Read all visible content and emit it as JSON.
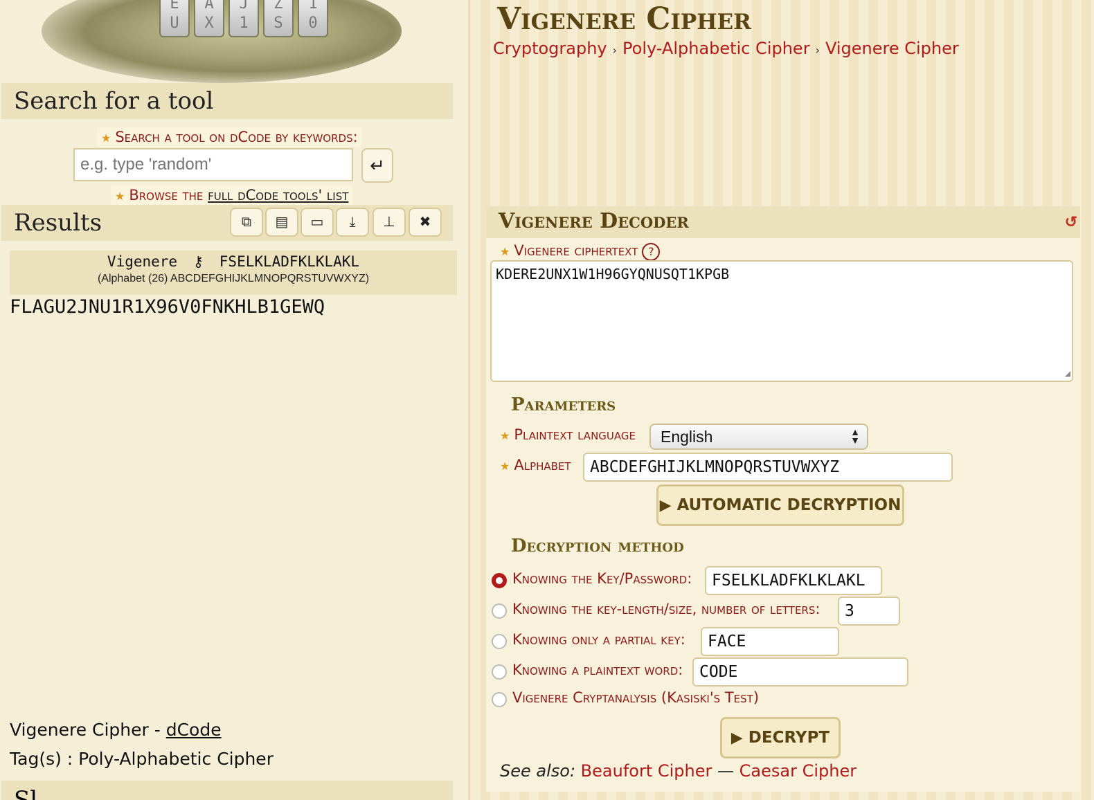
{
  "left": {
    "lock_ring_letters": [
      "E",
      "U",
      "A",
      "X",
      "J",
      "1",
      "Z",
      "S",
      "1",
      "0"
    ],
    "search_heading": "Search for a tool",
    "search_hint": "Search a tool on dCode by keywords:",
    "search_placeholder": "e.g. type 'random'",
    "browse_prefix": "Browse the ",
    "browse_link": "full dCode tools' list",
    "results_heading": "Results",
    "result_cipher_name": "Vigenere",
    "result_key": "FSELKLADFKLKLAKL",
    "result_alphabet": "(Alphabet (26) ABCDEFGHIJKLMNOPQRSTUVWXYZ)",
    "result_plaintext": "FLAGU2JNU1R1X96V0FNKHLB1GEWQ",
    "footer_title": "Vigenere Cipher - ",
    "footer_link": "dCode",
    "footer_tags": "Tag(s) : Poly-Alphabetic Cipher",
    "bottom_cut_heading": "Sl"
  },
  "right": {
    "page_title": "Vigenere Cipher",
    "breadcrumb": [
      "Cryptography",
      "Poly-Alphabetic Cipher",
      "Vigenere Cipher"
    ],
    "decoder_title": "Vigenere Decoder",
    "ciphertext_label": "Vigenere ciphertext",
    "ciphertext_value": "KDERE2UNX1W1H96GYQNUSQT1KPGB",
    "parameters_heading": "Parameters",
    "language_label": "Plaintext language",
    "language_value": "English",
    "alphabet_label": "Alphabet",
    "alphabet_value": "ABCDEFGHIJKLMNOPQRSTUVWXYZ",
    "auto_button": "AUTOMATIC DECRYPTION",
    "method_heading": "Decryption method",
    "methods": [
      {
        "label": "Knowing the Key/Password:",
        "value": "FSELKLADFKLKLAKL",
        "checked": true
      },
      {
        "label": "Knowing the key-length/size, number of letters:",
        "value": "3",
        "checked": false
      },
      {
        "label": "Knowing only a partial key:",
        "value": "FACE",
        "checked": false
      },
      {
        "label": "Knowing a plaintext word:",
        "value": "CODE",
        "checked": false
      },
      {
        "label": "Vigenere Cryptanalysis (Kasiski's Test)",
        "checked": false
      }
    ],
    "decrypt_button": "DECRYPT",
    "see_also_label": "See also: ",
    "see_also_links": [
      "Beaufort Cipher",
      "Caesar Cipher"
    ],
    "see_also_sep": " — "
  },
  "icons": {
    "enter": "↵",
    "toolbar": [
      "copy-icon",
      "save-icon",
      "print-icon",
      "download-icon",
      "pin-icon",
      "close-icon"
    ],
    "reset": "↺"
  },
  "colors": {
    "accent_red": "#b01c1c",
    "title_brown": "#5a4512",
    "panel_beige": "#ece1bd"
  }
}
